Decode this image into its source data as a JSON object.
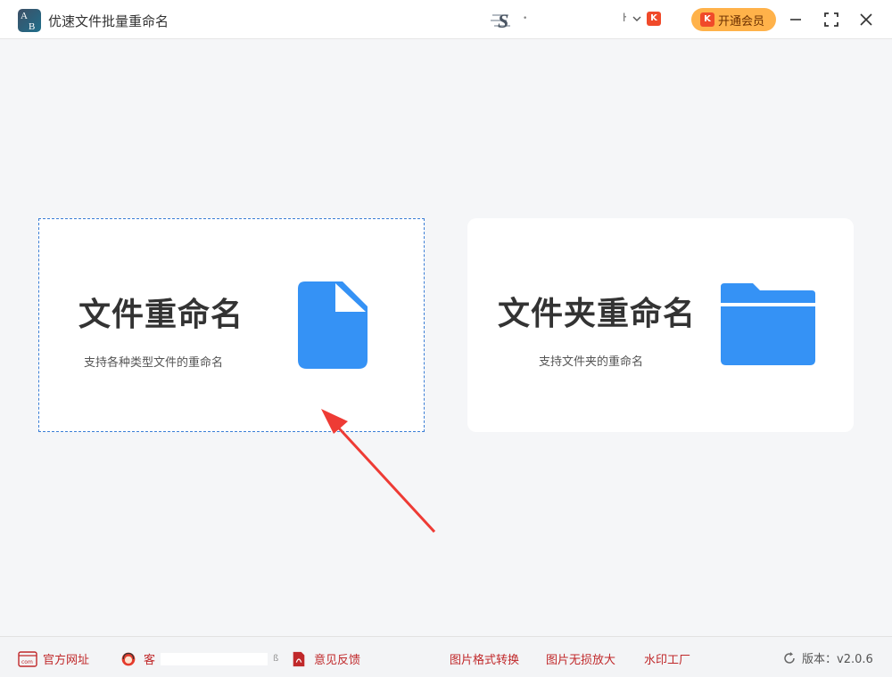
{
  "window": {
    "app_title": "优速文件批量重命名",
    "logo_text_a": "A",
    "logo_text_b": "B",
    "account_tail": "ŀ",
    "vip_badge_letter": "K",
    "vip_button_label": "开通会员",
    "icons": [
      "app-logo",
      "user-avatar-logo",
      "chevron-down-icon",
      "vip-icon",
      "minimize-icon",
      "maximize-icon",
      "close-icon"
    ]
  },
  "cards": {
    "file": {
      "title": "文件重命名",
      "subtitle": "支持各种类型文件的重命名",
      "icon": "file-icon",
      "selected": true
    },
    "folder": {
      "title": "文件夹重命名",
      "subtitle": "支持文件夹的重命名",
      "icon": "folder-icon"
    }
  },
  "footer": {
    "site_label": "官方网址",
    "site_icon_text": "com",
    "service_label": "客",
    "service_tail": "ß",
    "feedback_label": "意见反馈",
    "links": [
      "图片格式转换",
      "图片无损放大",
      "水印工厂"
    ],
    "version_label": "版本：v2.0.6"
  },
  "colors": {
    "accent_blue": "#3592f5",
    "footer_red": "#c0282a",
    "vip_orange": "#ffb24a",
    "arrow_red": "#ee3b35"
  }
}
